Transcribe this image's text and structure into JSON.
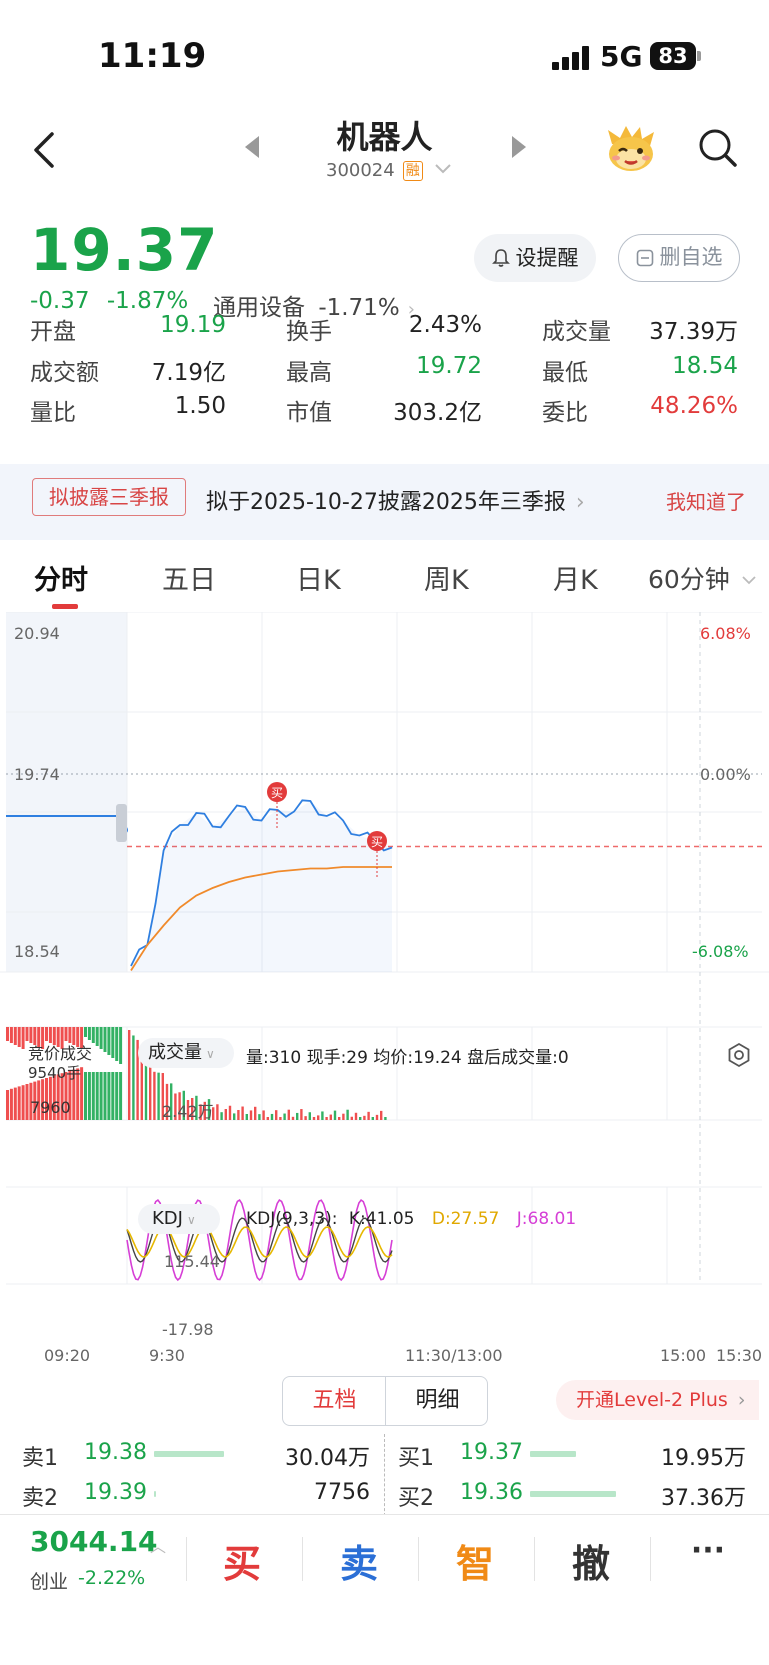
{
  "status_bar": {
    "time": "11:19",
    "network": "5G",
    "battery": "83"
  },
  "header": {
    "title": "机器人",
    "code": "300024",
    "badge": "融"
  },
  "quote": {
    "price": "19.37",
    "change": "-0.37",
    "change_pct": "-1.87%",
    "sector_name": "通用设备",
    "sector_pct": "-1.71%",
    "remind_label": "设提醒",
    "remove_label": "删自选",
    "stats": [
      {
        "key": "开盘",
        "value": "19.19",
        "color": "green"
      },
      {
        "key": "换手",
        "value": "2.43%",
        "color": "black"
      },
      {
        "key": "成交量",
        "value": "37.39万",
        "color": "black"
      },
      {
        "key": "成交额",
        "value": "7.19亿",
        "color": "black"
      },
      {
        "key": "最高",
        "value": "19.72",
        "color": "green"
      },
      {
        "key": "最低",
        "value": "18.54",
        "color": "green"
      },
      {
        "key": "量比",
        "value": "1.50",
        "color": "black"
      },
      {
        "key": "市值",
        "value": "303.2亿",
        "color": "black"
      },
      {
        "key": "委比",
        "value": "48.26%",
        "color": "red"
      }
    ]
  },
  "notice": {
    "tag": "拟披露三季报",
    "text": "拟于2025-10-27披露2025年三季报",
    "close": "我知道了"
  },
  "tabs": [
    "分时",
    "五日",
    "日K",
    "周K",
    "月K",
    "60分钟"
  ],
  "chart": {
    "price_top": "20.94",
    "price_mid": "19.74",
    "price_bottom": "18.54",
    "pct_top": "6.08%",
    "pct_mid": "0.00%",
    "pct_bottom": "-6.08%",
    "buy_marker": "买",
    "auction_label": "竞价成交",
    "auction_value": "9540手",
    "volume_selector": "成交量",
    "volume_info": "量:310  现手:29  均价:19.24  盘后成交量:0",
    "volume_left_max": "7960",
    "volume_right_max": "2.42万",
    "kdj_selector": "KDJ",
    "kdj_params": "KDJ(9,3,3):",
    "kdj_k": "K:41.05",
    "kdj_d": "D:27.57",
    "kdj_j": "J:68.01",
    "kdj_top": "115.44",
    "kdj_bottom": "-17.98",
    "time_labels": [
      "09:20",
      "9:30",
      "11:30/13:00",
      "15:00",
      "15:30"
    ],
    "colors": {
      "price_line": "#2f7fe0",
      "avg_line": "#f08a2b",
      "up": "#ef4f4f",
      "down": "#33b164",
      "d_line": "#e6b800",
      "j_line": "#d63fd6"
    }
  },
  "chart_data": {
    "type": "line",
    "title": "",
    "series": [
      {
        "name": "",
        "unit": "price",
        "values": [
          18.58,
          18.72,
          19.35,
          19.52,
          19.6,
          19.51,
          19.58,
          19.64,
          19.55,
          19.62,
          19.61,
          19.68,
          19.58,
          19.55,
          19.45,
          19.41,
          19.37
        ]
      },
      {
        "name": "",
        "unit": "price",
        "values": [
          18.55,
          18.72,
          18.85,
          18.97,
          19.05,
          19.1,
          19.14,
          19.17,
          19.19,
          19.21,
          19.22,
          19.23,
          19.23,
          19.24,
          19.24,
          19.24,
          19.24
        ]
      }
    ],
    "ylim": [
      18.54,
      20.94
    ]
  },
  "orderbook": {
    "tab_active": "五档",
    "tab_other": "明细",
    "level2": "开通Level-2 Plus",
    "sell": [
      {
        "label": "卖1",
        "price": "19.38",
        "volume": "30.04万",
        "ratio": 0.58
      },
      {
        "label": "卖2",
        "price": "19.39",
        "volume": "7756",
        "ratio": 0.01
      }
    ],
    "buy": [
      {
        "label": "买1",
        "price": "19.37",
        "volume": "19.95万",
        "ratio": 0.38
      },
      {
        "label": "买2",
        "price": "19.36",
        "volume": "37.36万",
        "ratio": 0.72
      }
    ]
  },
  "bottom_bar": {
    "index_value": "3044.14",
    "index_name": "创业",
    "index_change": "-2.22%",
    "actions": [
      "买",
      "卖",
      "智",
      "撤",
      "···"
    ]
  }
}
